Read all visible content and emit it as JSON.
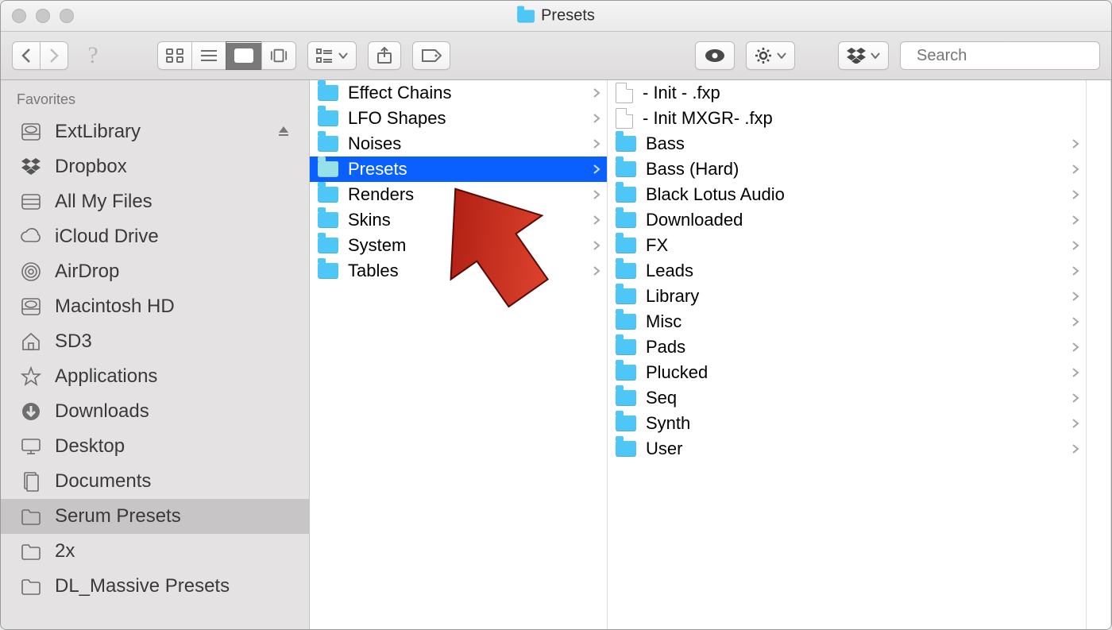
{
  "window": {
    "title": "Presets"
  },
  "toolbar": {
    "search_placeholder": "Search"
  },
  "sidebar": {
    "header": "Favorites",
    "items": [
      {
        "label": "ExtLibrary",
        "icon": "hdd",
        "ejectable": true
      },
      {
        "label": "Dropbox",
        "icon": "dropbox"
      },
      {
        "label": "All My Files",
        "icon": "allfiles"
      },
      {
        "label": "iCloud Drive",
        "icon": "cloud"
      },
      {
        "label": "AirDrop",
        "icon": "airdrop"
      },
      {
        "label": "Macintosh HD",
        "icon": "hdd"
      },
      {
        "label": "SD3",
        "icon": "home"
      },
      {
        "label": "Applications",
        "icon": "apps"
      },
      {
        "label": "Downloads",
        "icon": "download"
      },
      {
        "label": "Desktop",
        "icon": "desktop"
      },
      {
        "label": "Documents",
        "icon": "docs"
      },
      {
        "label": "Serum Presets",
        "icon": "folder",
        "selected": true
      },
      {
        "label": "2x",
        "icon": "folder"
      },
      {
        "label": "DL_Massive Presets",
        "icon": "folder"
      }
    ]
  },
  "column1": {
    "items": [
      {
        "label": "Effect Chains",
        "expandable": true
      },
      {
        "label": "LFO Shapes",
        "expandable": true
      },
      {
        "label": "Noises",
        "expandable": true
      },
      {
        "label": "Presets",
        "expandable": true,
        "selected": true
      },
      {
        "label": "Renders",
        "expandable": true
      },
      {
        "label": "Skins",
        "expandable": true
      },
      {
        "label": "System",
        "expandable": true
      },
      {
        "label": "Tables",
        "expandable": true
      }
    ]
  },
  "column2": {
    "items": [
      {
        "label": " - Init - .fxp",
        "type": "file"
      },
      {
        "label": " - Init MXGR- .fxp",
        "type": "file"
      },
      {
        "label": "Bass",
        "type": "folder",
        "expandable": true
      },
      {
        "label": "Bass (Hard)",
        "type": "folder",
        "expandable": true
      },
      {
        "label": "Black Lotus Audio",
        "type": "folder",
        "expandable": true
      },
      {
        "label": "Downloaded",
        "type": "folder",
        "expandable": true
      },
      {
        "label": "FX",
        "type": "folder",
        "expandable": true
      },
      {
        "label": "Leads",
        "type": "folder",
        "expandable": true
      },
      {
        "label": "Library",
        "type": "folder",
        "expandable": true
      },
      {
        "label": "Misc",
        "type": "folder",
        "expandable": true
      },
      {
        "label": "Pads",
        "type": "folder",
        "expandable": true
      },
      {
        "label": "Plucked",
        "type": "folder",
        "expandable": true
      },
      {
        "label": "Seq",
        "type": "folder",
        "expandable": true
      },
      {
        "label": "Synth",
        "type": "folder",
        "expandable": true
      },
      {
        "label": "User",
        "type": "folder",
        "expandable": true
      }
    ]
  }
}
